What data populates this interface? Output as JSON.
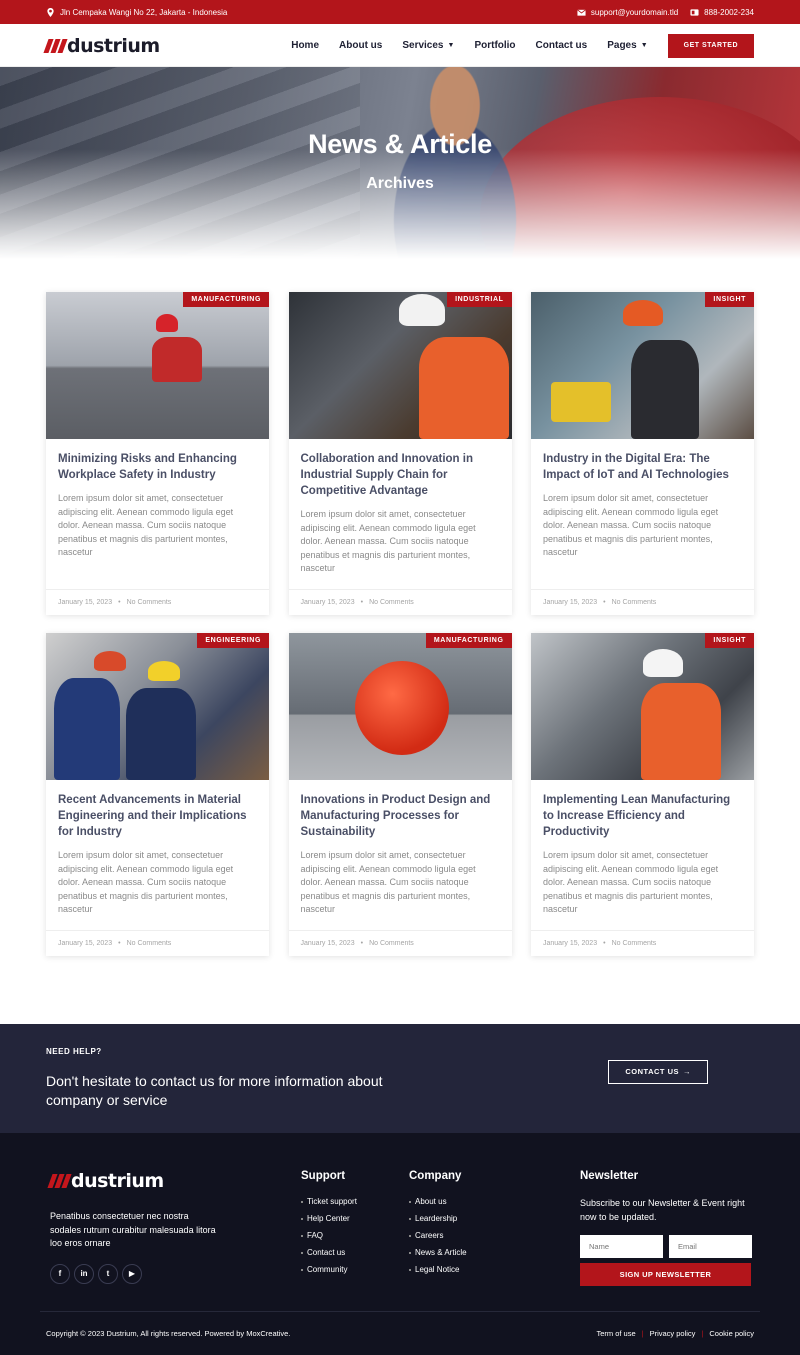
{
  "topbar": {
    "address": "Jln Cempaka Wangi No 22, Jakarta - Indonesia",
    "email": "support@yourdomain.tld",
    "phone": "888-2002-234"
  },
  "header": {
    "logo_text": "dustrium",
    "nav": [
      {
        "label": "Home"
      },
      {
        "label": "About us"
      },
      {
        "label": "Services",
        "dropdown": true
      },
      {
        "label": "Portfolio"
      },
      {
        "label": "Contact us"
      },
      {
        "label": "Pages",
        "dropdown": true
      }
    ],
    "cta_label": "GET STARTED"
  },
  "hero": {
    "title": "News & Article",
    "subtitle": "Archives"
  },
  "articles": [
    {
      "category": "MANUFACTURING",
      "title": "Minimizing Risks and Enhancing Workplace Safety in Industry",
      "excerpt": "Lorem ipsum dolor sit amet, consectetuer adipiscing elit. Aenean commodo ligula eget dolor. Aenean massa. Cum sociis natoque penatibus et magnis dis parturient montes, nascetur",
      "date": "January 15, 2023",
      "comments": "No Comments"
    },
    {
      "category": "INDUSTRIAL",
      "title": "Collaboration and Innovation in Industrial Supply Chain for Competitive Advantage",
      "excerpt": "Lorem ipsum dolor sit amet, consectetuer adipiscing elit. Aenean commodo ligula eget dolor. Aenean massa. Cum sociis natoque penatibus et magnis dis parturient montes, nascetur",
      "date": "January 15, 2023",
      "comments": "No Comments"
    },
    {
      "category": "INSIGHT",
      "title": "Industry in the Digital Era: The Impact of IoT and AI Technologies",
      "excerpt": "Lorem ipsum dolor sit amet, consectetuer adipiscing elit. Aenean commodo ligula eget dolor. Aenean massa. Cum sociis natoque penatibus et magnis dis parturient montes, nascetur",
      "date": "January 15, 2023",
      "comments": "No Comments"
    },
    {
      "category": "ENGINEERING",
      "title": "Recent Advancements in Material Engineering and their Implications for Industry",
      "excerpt": "Lorem ipsum dolor sit amet, consectetuer adipiscing elit. Aenean commodo ligula eget dolor. Aenean massa. Cum sociis natoque penatibus et magnis dis parturient montes, nascetur",
      "date": "January 15, 2023",
      "comments": "No Comments"
    },
    {
      "category": "MANUFACTURING",
      "title": "Innovations in Product Design and Manufacturing Processes for Sustainability",
      "excerpt": "Lorem ipsum dolor sit amet, consectetuer adipiscing elit. Aenean commodo ligula eget dolor. Aenean massa. Cum sociis natoque penatibus et magnis dis parturient montes, nascetur",
      "date": "January 15, 2023",
      "comments": "No Comments"
    },
    {
      "category": "INSIGHT",
      "title": "Implementing Lean Manufacturing to Increase Efficiency and Productivity",
      "excerpt": "Lorem ipsum dolor sit amet, consectetuer adipiscing elit. Aenean commodo ligula eget dolor. Aenean massa. Cum sociis natoque penatibus et magnis dis parturient montes, nascetur",
      "date": "January 15, 2023",
      "comments": "No Comments"
    }
  ],
  "help": {
    "kicker": "NEED HELP?",
    "text": "Don't hesitate to contact us for more information about company or service",
    "button_label": "CONTACT US",
    "button_arrow": "→"
  },
  "footer": {
    "logo_text": "dustrium",
    "description": "Penatibus consectetuer nec nostra sodales rutrum curabitur malesuada litora loo eros ornare",
    "socials": [
      {
        "icon": "facebook-icon",
        "glyph": "f"
      },
      {
        "icon": "linkedin-icon",
        "glyph": "in"
      },
      {
        "icon": "twitter-icon",
        "glyph": "t"
      },
      {
        "icon": "youtube-icon",
        "glyph": "▶"
      }
    ],
    "support": {
      "heading": "Support",
      "links": [
        "Ticket support",
        "Help Center",
        "FAQ",
        "Contact us",
        "Community"
      ]
    },
    "company": {
      "heading": "Company",
      "links": [
        "About us",
        "Leardership",
        "Careers",
        "News & Article",
        "Legal Notice"
      ]
    },
    "newsletter": {
      "heading": "Newsletter",
      "text": "Subscribe to our Newsletter & Event right now to be updated.",
      "name_placeholder": "Name",
      "email_placeholder": "Email",
      "button_label": "SIGN UP NEWSLETTER"
    },
    "copyright": "Copyright © 2023 Dustrium, All rights reserved. Powered by MoxCreative.",
    "legal_links": [
      "Term of use",
      "Privacy policy",
      "Cookie policy"
    ],
    "legal_separator": "|"
  },
  "colors": {
    "brand_red": "#b3151b",
    "dark_navy": "#23253a",
    "footer_bg": "#11121f",
    "title_text": "#4a4f66"
  }
}
